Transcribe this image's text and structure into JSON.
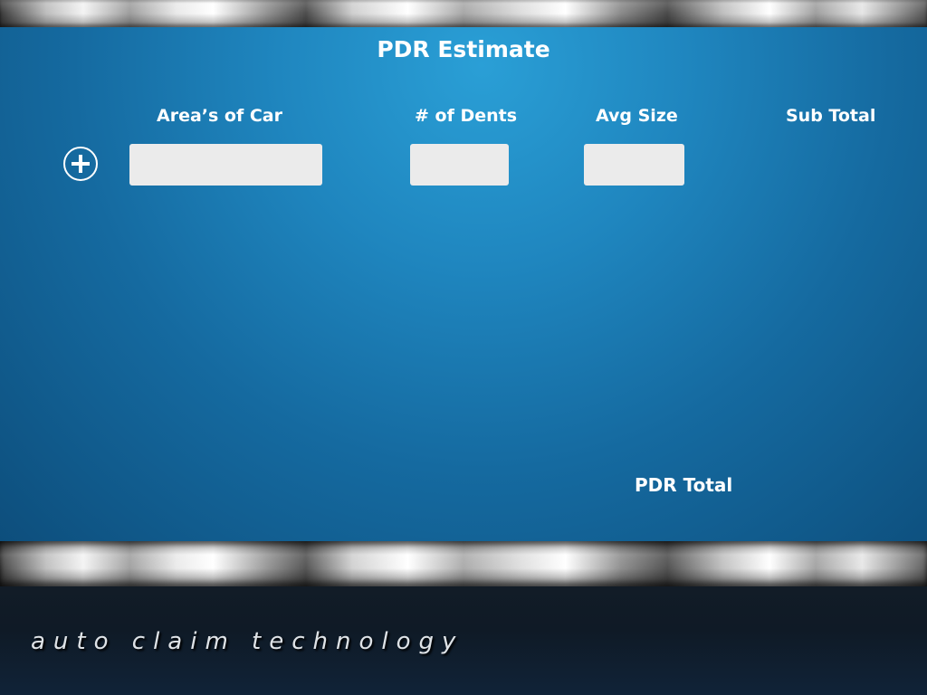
{
  "header": {
    "title": "PDR Estimate"
  },
  "columns": {
    "area": "Area’s of Car",
    "dents": "# of Dents",
    "avg_size": "Avg Size",
    "sub_total": "Sub Total"
  },
  "row": {
    "area_value": "",
    "dents_value": "",
    "avg_size_value": ""
  },
  "summary": {
    "total_label": "PDR Total"
  },
  "footer": {
    "brand": "auto claim technology"
  },
  "icons": {
    "add": "plus-circle-icon"
  }
}
